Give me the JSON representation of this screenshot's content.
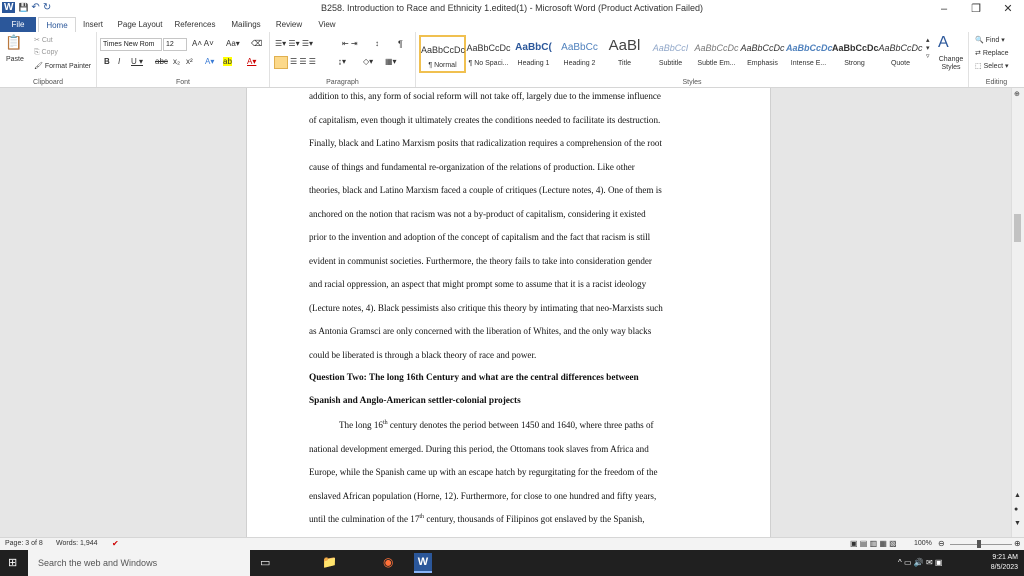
{
  "window": {
    "title": "B258. Introduction to Race and Ethnicity 1.edited(1)  -  Microsoft Word (Product Activation Failed)",
    "minimize": "–",
    "restore": "❐",
    "close": "✕"
  },
  "qat": {
    "word_icon": "W",
    "save_icon": "💾",
    "undo": "↶",
    "redo": "↻"
  },
  "tabs": [
    "File",
    "Home",
    "Insert",
    "Page Layout",
    "References",
    "Mailings",
    "Review",
    "View"
  ],
  "ribbon": {
    "clipboard": {
      "paste": "Paste",
      "cut": "Cut",
      "copy": "Copy",
      "format_painter": "Format Painter",
      "label": "Clipboard"
    },
    "font": {
      "name": "Times New Rom",
      "size": "12",
      "label": "Font"
    },
    "paragraph": {
      "label": "Paragraph"
    },
    "styles": {
      "label": "Styles",
      "items": [
        {
          "preview": "AaBbCcDc",
          "name": "¶ Normal"
        },
        {
          "preview": "AaBbCcDc",
          "name": "¶ No Spaci..."
        },
        {
          "preview": "AaBbC(",
          "name": "Heading 1"
        },
        {
          "preview": "AaBbCc",
          "name": "Heading 2"
        },
        {
          "preview": "AaBl",
          "name": "Title"
        },
        {
          "preview": "AaBbCcI",
          "name": "Subtitle"
        },
        {
          "preview": "AaBbCcDc",
          "name": "Subtle Em..."
        },
        {
          "preview": "AaBbCcDc",
          "name": "Emphasis"
        },
        {
          "preview": "AaBbCcDc",
          "name": "Intense E..."
        },
        {
          "preview": "AaBbCcDc",
          "name": "Strong"
        },
        {
          "preview": "AaBbCcDc",
          "name": "Quote"
        }
      ],
      "change_styles": "Change Styles"
    },
    "editing": {
      "find": "Find",
      "replace": "Replace",
      "select": "Select",
      "label": "Editing"
    }
  },
  "document": {
    "lines_top": [
      "addition to this, any form of social reform will not take off, largely due to the immense influence",
      "of capitalism, even though it ultimately creates the conditions needed to facilitate its destruction.",
      "Finally, black and Latino Marxism posits that radicalization requires a comprehension of the root",
      "cause of things and fundamental re-organization of the relations of production. Like other",
      "theories, black and Latino Marxism faced a couple of critiques (Lecture notes, 4). One of them is",
      "anchored on the notion that racism was not a by-product of capitalism, considering it existed",
      "prior to the invention and adoption of the concept of capitalism and the fact that racism is still",
      "evident in communist societies. Furthermore, the theory fails to take into consideration gender",
      "and racial oppression, an aspect that might prompt some to assume that it is a racist ideology",
      "(Lecture notes, 4). Black pessimists also critique this theory by intimating that neo-Marxists such",
      "as Antonia Gramsci are only concerned with the liberation of Whites, and the only way blacks",
      "could be liberated is through a black theory of race and power."
    ],
    "heading1": "Question Two: The long 16th Century and what are the central differences between",
    "heading2": "Spanish and Anglo-American settler-colonial projects",
    "p2_line1_a": "The long 16",
    "p2_line1_sup": "th",
    "p2_line1_b": " century denotes the period between 1450 and 1640, where three paths of",
    "lines_bottom": [
      "national development emerged. During this period, the Ottomans took slaves from Africa and",
      "Europe, while the Spanish came up with an escape hatch by regurgitating for the freedom of the",
      "enslaved African population (Horne, 12). Furthermore, for close to one hundred and fifty years,"
    ],
    "p2_last_a": "until the culmination of the 17",
    "p2_last_sup": "th",
    "p2_last_b": " century, thousands of Filipinos got enslaved by the Spanish,"
  },
  "status": {
    "page": "Page: 3 of 8",
    "words": "Words: 1,944",
    "zoom": "100%"
  },
  "taskbar": {
    "search_placeholder": "Search the web and Windows",
    "time": "9:21 AM",
    "date": "8/5/2023"
  }
}
